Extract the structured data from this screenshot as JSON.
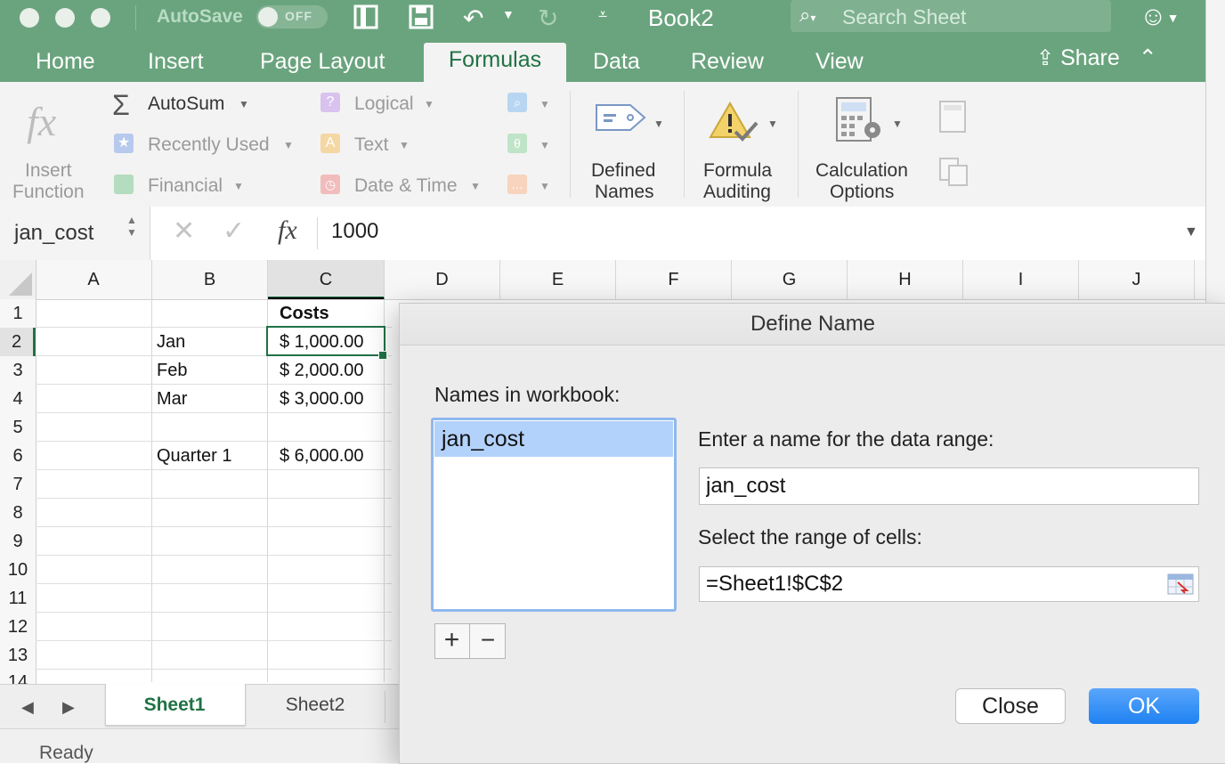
{
  "window": {
    "title": "Book2",
    "autosave_label": "AutoSave",
    "autosave_state": "OFF",
    "search_placeholder": "Search Sheet"
  },
  "tabs": [
    "Home",
    "Insert",
    "Page Layout",
    "Formulas",
    "Data",
    "Review",
    "View"
  ],
  "active_tab": "Formulas",
  "share_label": "Share",
  "ribbon": {
    "insert_function": [
      "Insert",
      "Function"
    ],
    "autosum": "AutoSum",
    "recently_used": "Recently Used",
    "financial": "Financial",
    "logical": "Logical",
    "text": "Text",
    "date_time": "Date & Time",
    "defined_names": [
      "Defined",
      "Names"
    ],
    "formula_auditing": [
      "Formula",
      "Auditing"
    ],
    "calculation_options": [
      "Calculation",
      "Options"
    ]
  },
  "formula_bar": {
    "name_box": "jan_cost",
    "value": "1000",
    "fx": "fx"
  },
  "columns": [
    "A",
    "B",
    "C",
    "D",
    "E",
    "F",
    "G",
    "H",
    "I",
    "J"
  ],
  "rows": [
    "1",
    "2",
    "3",
    "4",
    "5",
    "6",
    "7",
    "8",
    "9",
    "10",
    "11",
    "12",
    "13",
    "14"
  ],
  "cells": {
    "C1": "Costs",
    "B2": "Jan",
    "C2": "$ 1,000.00",
    "B3": "Feb",
    "C3": "$ 2,000.00",
    "B4": "Mar",
    "C4": "$ 3,000.00",
    "B6": "Quarter 1",
    "C6": "$ 6,000.00"
  },
  "sheets": [
    "Sheet1",
    "Sheet2"
  ],
  "active_sheet": "Sheet1",
  "status": "Ready",
  "dialog": {
    "title": "Define Name",
    "names_label": "Names in workbook:",
    "names": [
      "jan_cost"
    ],
    "name_label": "Enter a name for the data range:",
    "name_value": "jan_cost",
    "range_label": "Select the range of cells:",
    "range_value": "=Sheet1!$C$2",
    "add_symbol": "+",
    "remove_symbol": "−",
    "close_label": "Close",
    "ok_label": "OK"
  },
  "colors": {
    "title_green": "#6aa47e",
    "excel_green": "#207245",
    "ok_blue": "#2d8ef5",
    "selection_blue": "#b3d2fb"
  }
}
